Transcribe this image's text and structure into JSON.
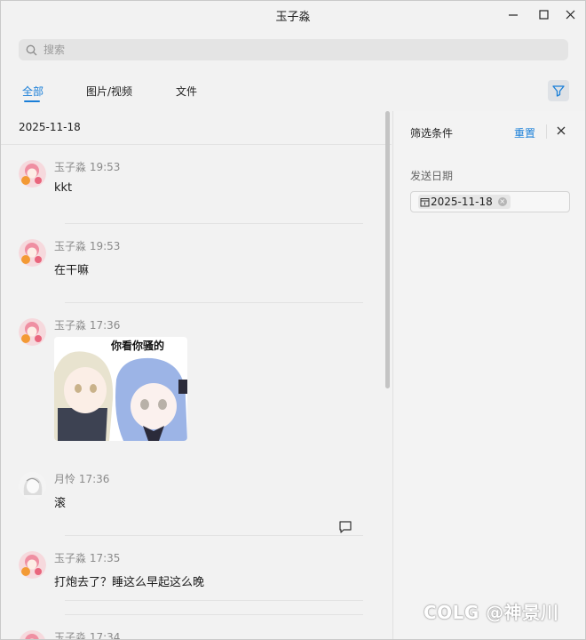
{
  "window": {
    "title": "玉子淼"
  },
  "search": {
    "placeholder": "搜索"
  },
  "tabs": [
    {
      "label": "全部",
      "active": true
    },
    {
      "label": "图片/视频",
      "active": false
    },
    {
      "label": "文件",
      "active": false
    }
  ],
  "date_header": "2025-11-18",
  "messages": [
    {
      "sender": "玉子淼",
      "time": "19:53",
      "text": "kkt"
    },
    {
      "sender": "玉子淼",
      "time": "19:53",
      "text": "在干嘛"
    },
    {
      "sender": "玉子淼",
      "time": "17:36",
      "sticker_caption": "你看你骚的"
    },
    {
      "sender": "月怜",
      "time": "17:36",
      "text": "滚"
    },
    {
      "sender": "玉子淼",
      "time": "17:35",
      "text": "打炮去了？睡这么早起这么晚"
    },
    {
      "sender": "玉子淼",
      "time": "17:34",
      "text": ""
    }
  ],
  "filter_panel": {
    "title": "筛选条件",
    "reset_label": "重置",
    "date_label": "发送日期",
    "date_chip": "2025-11-18"
  },
  "watermark": "COLG @神景川",
  "colors": {
    "accent": "#1a7fd8",
    "background": "#f2f2f2"
  }
}
